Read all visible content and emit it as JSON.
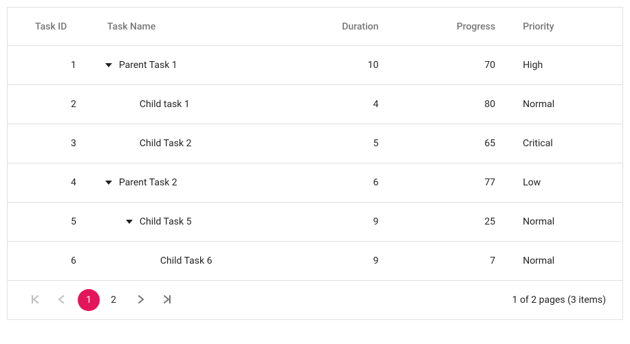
{
  "columns": {
    "task_id": "Task ID",
    "task_name": "Task Name",
    "duration": "Duration",
    "progress": "Progress",
    "priority": "Priority"
  },
  "rows": [
    {
      "id": "1",
      "name": "Parent Task 1",
      "duration": "10",
      "progress": "70",
      "priority": "High",
      "level": 0,
      "expandable": true
    },
    {
      "id": "2",
      "name": "Child task 1",
      "duration": "4",
      "progress": "80",
      "priority": "Normal",
      "level": 1,
      "expandable": false
    },
    {
      "id": "3",
      "name": "Child Task 2",
      "duration": "5",
      "progress": "65",
      "priority": "Critical",
      "level": 1,
      "expandable": false
    },
    {
      "id": "4",
      "name": "Parent Task 2",
      "duration": "6",
      "progress": "77",
      "priority": "Low",
      "level": 0,
      "expandable": true
    },
    {
      "id": "5",
      "name": "Child Task 5",
      "duration": "9",
      "progress": "25",
      "priority": "Normal",
      "level": 1,
      "expandable": true
    },
    {
      "id": "6",
      "name": "Child Task 6",
      "duration": "9",
      "progress": "7",
      "priority": "Normal",
      "level": 2,
      "expandable": false
    }
  ],
  "pager": {
    "pages": [
      "1",
      "2"
    ],
    "active": "1",
    "info": "1 of 2 pages (3 items)"
  }
}
